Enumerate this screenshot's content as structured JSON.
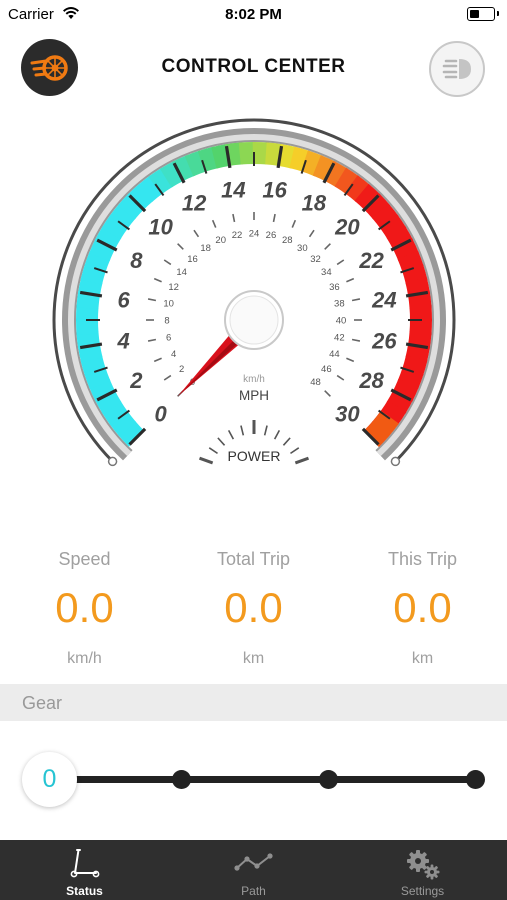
{
  "status_bar": {
    "carrier": "Carrier",
    "time": "8:02 PM"
  },
  "header": {
    "title": "CONTROL CENTER",
    "logo_icon": "flaming-wheel-icon",
    "headlight_icon": "headlight-icon"
  },
  "gauge": {
    "mph_labels": [
      "0",
      "2",
      "4",
      "6",
      "8",
      "10",
      "12",
      "14",
      "16",
      "18",
      "20",
      "22",
      "24",
      "26",
      "28",
      "30"
    ],
    "kmh_labels": [
      "0",
      "2",
      "4",
      "6",
      "8",
      "10",
      "12",
      "14",
      "16",
      "18",
      "20",
      "22",
      "24",
      "26",
      "28",
      "30",
      "32",
      "34",
      "36",
      "38",
      "40",
      "42",
      "44",
      "46",
      "48"
    ],
    "kmh_unit": "km/h",
    "mph_unit": "MPH",
    "power_label": "POWER",
    "speed_mph": 0,
    "max_mph": 30,
    "colors": {
      "low": "#35e6f0",
      "mid": "#53d36a",
      "high": "#f5dd2a",
      "max": "#f01818",
      "needle": "#d9111c"
    }
  },
  "stats": [
    {
      "label": "Speed",
      "value": "0.0",
      "unit": "km/h"
    },
    {
      "label": "Total Trip",
      "value": "0.0",
      "unit": "km"
    },
    {
      "label": "This Trip",
      "value": "0.0",
      "unit": "km"
    }
  ],
  "gear": {
    "label": "Gear",
    "value": "0",
    "levels": 4
  },
  "tabs": [
    {
      "label": "Status",
      "icon": "scooter-icon",
      "active": true
    },
    {
      "label": "Path",
      "icon": "path-icon",
      "active": false
    },
    {
      "label": "Settings",
      "icon": "gears-icon",
      "active": false
    }
  ]
}
